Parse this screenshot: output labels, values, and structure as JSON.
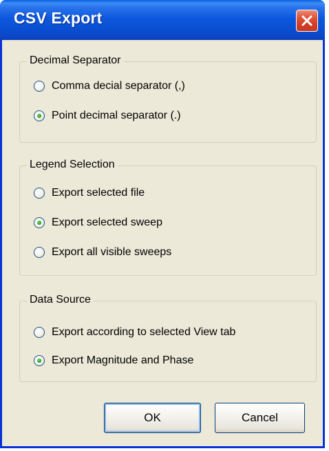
{
  "window": {
    "title": "CSV Export"
  },
  "groups": {
    "decimal": {
      "legend": "Decimal Separator",
      "options": [
        {
          "label": "Comma decial separator (,)",
          "checked": false
        },
        {
          "label": "Point decimal separator (.)",
          "checked": true
        }
      ]
    },
    "legend_selection": {
      "legend": "Legend Selection",
      "options": [
        {
          "label": "Export selected file",
          "checked": false
        },
        {
          "label": "Export selected sweep",
          "checked": true
        },
        {
          "label": "Export all visible sweeps",
          "checked": false
        }
      ]
    },
    "data_source": {
      "legend": "Data Source",
      "options": [
        {
          "label": "Export according to selected View tab",
          "checked": false
        },
        {
          "label": "Export Magnitude and Phase",
          "checked": true
        }
      ]
    }
  },
  "buttons": {
    "ok_label": "OK",
    "cancel_label": "Cancel"
  },
  "icons": {
    "close": "close-icon"
  },
  "colors": {
    "title_bar": "#0a4fd3",
    "close_button": "#e0553a",
    "dialog_background": "#ece9d8",
    "radio_dot": "#21a121"
  }
}
